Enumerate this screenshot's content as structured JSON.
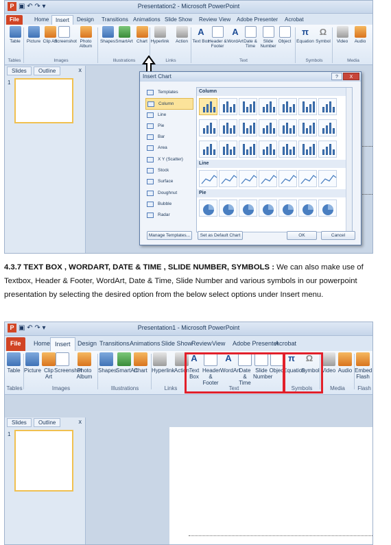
{
  "shot1": {
    "app_title": "Presentation2 - Microsoft PowerPoint",
    "tabs": [
      "File",
      "Home",
      "Insert",
      "Design",
      "Transitions",
      "Animations",
      "Slide Show",
      "Review",
      "View",
      "Adobe Presenter",
      "Acrobat"
    ],
    "ribbon_items": [
      {
        "label": "Table",
        "icon": "table-icon"
      },
      {
        "label": "Picture",
        "icon": "picture-icon"
      },
      {
        "label": "Clip Art",
        "icon": "clip-art-icon"
      },
      {
        "label": "Screenshot",
        "icon": "screenshot-icon"
      },
      {
        "label": "Photo Album",
        "icon": "photo-album-icon"
      },
      {
        "label": "Shapes",
        "icon": "shapes-icon"
      },
      {
        "label": "SmartArt",
        "icon": "smartart-icon"
      },
      {
        "label": "Chart",
        "icon": "chart-icon"
      },
      {
        "label": "Hyperlink",
        "icon": "hyperlink-icon"
      },
      {
        "label": "Action",
        "icon": "action-icon"
      },
      {
        "label": "Text Box",
        "icon": "text-box-icon"
      },
      {
        "label": "Header & Footer",
        "icon": "header-footer-icon"
      },
      {
        "label": "WordArt",
        "icon": "wordart-icon"
      },
      {
        "label": "Date & Time",
        "icon": "date-time-icon"
      },
      {
        "label": "Slide Number",
        "icon": "slide-number-icon"
      },
      {
        "label": "Object",
        "icon": "object-icon"
      },
      {
        "label": "Equation",
        "icon": "equation-icon"
      },
      {
        "label": "Symbol",
        "icon": "symbol-icon"
      },
      {
        "label": "Video",
        "icon": "video-icon"
      },
      {
        "label": "Audio",
        "icon": "audio-icon"
      }
    ],
    "groups": [
      "Tables",
      "Images",
      "Illustrations",
      "Links",
      "Text",
      "Symbols",
      "Media"
    ],
    "pane_tabs": [
      "Slides",
      "Outline"
    ],
    "pane_close": "x",
    "slide_number": "1",
    "dialog": {
      "title": "Insert Chart",
      "help": "?",
      "close": "X",
      "categories": [
        "Templates",
        "Column",
        "Line",
        "Pie",
        "Bar",
        "Area",
        "X Y (Scatter)",
        "Stock",
        "Surface",
        "Doughnut",
        "Bubble",
        "Radar"
      ],
      "selected_category": "Column",
      "section_column": "Column",
      "section_line": "Line",
      "section_pie": "Pie",
      "manage_templates": "Manage Templates...",
      "set_default": "Set as Default Chart",
      "ok": "OK",
      "cancel": "Cancel"
    }
  },
  "paragraph": {
    "heading": "4.3.7 TEXT BOX , WORDART, DATE & TIME , SLIDE NUMBER, SYMBOLS :",
    "body": " We can also make use of Textbox, Header & Footer, WordArt, Date & Time, Slide Number and various symbols in our powerpoint presentation by selecting the desired option from the below select options under Insert menu."
  },
  "shot2": {
    "app_title": "Presentation1 - Microsoft PowerPoint",
    "tabs": [
      "File",
      "Home",
      "Insert",
      "Design",
      "Transitions",
      "Animations",
      "Slide Show",
      "Review",
      "View",
      "Adobe Presenter",
      "Acrobat"
    ],
    "ribbon_items": [
      {
        "label": "Table",
        "icon": "table-icon"
      },
      {
        "label": "Picture",
        "icon": "picture-icon"
      },
      {
        "label": "Clip Art",
        "icon": "clip-art-icon"
      },
      {
        "label": "Screenshot",
        "icon": "screenshot-icon"
      },
      {
        "label": "Photo Album",
        "icon": "photo-album-icon"
      },
      {
        "label": "Shapes",
        "icon": "shapes-icon"
      },
      {
        "label": "SmartArt",
        "icon": "smartart-icon"
      },
      {
        "label": "Chart",
        "icon": "chart-icon"
      },
      {
        "label": "Hyperlink",
        "icon": "hyperlink-icon"
      },
      {
        "label": "Action",
        "icon": "action-icon"
      },
      {
        "label": "Text Box",
        "icon": "text-box-icon"
      },
      {
        "label": "Header & Footer",
        "icon": "header-footer-icon"
      },
      {
        "label": "WordArt",
        "icon": "wordart-icon"
      },
      {
        "label": "Date & Time",
        "icon": "date-time-icon"
      },
      {
        "label": "Slide Number",
        "icon": "slide-number-icon"
      },
      {
        "label": "Object",
        "icon": "object-icon"
      },
      {
        "label": "Equation",
        "icon": "equation-icon"
      },
      {
        "label": "Symbol",
        "icon": "symbol-icon"
      },
      {
        "label": "Video",
        "icon": "video-icon"
      },
      {
        "label": "Audio",
        "icon": "audio-icon"
      },
      {
        "label": "Embed Flash",
        "icon": "embed-flash-icon"
      }
    ],
    "groups": [
      "Tables",
      "Images",
      "Illustrations",
      "Links",
      "Text",
      "Symbols",
      "Media",
      "Flash"
    ],
    "pane_tabs": [
      "Slides",
      "Outline"
    ],
    "pane_close": "x",
    "slide_number": "1"
  },
  "colors": {
    "file_tab": "#d14424",
    "highlight": "#e2202a",
    "selected_item": "#fbe39a"
  }
}
